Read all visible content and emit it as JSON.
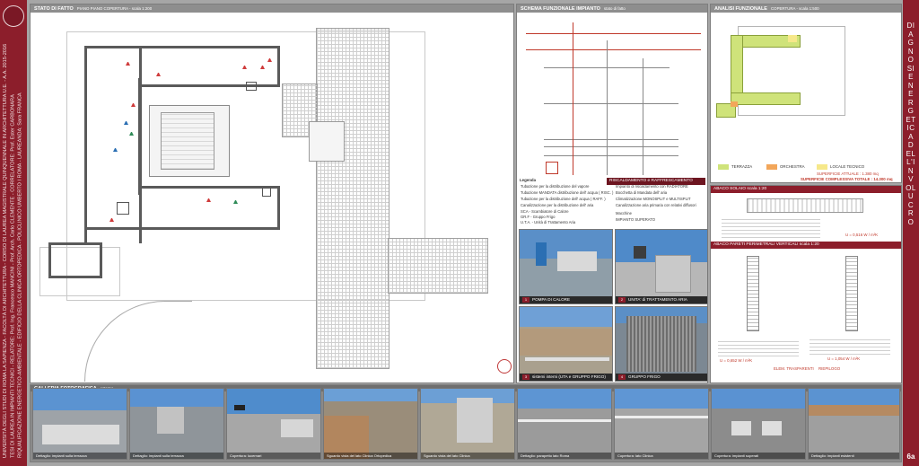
{
  "left_strip": {
    "lines": [
      "UNIVERSITÀ DEGLI STUDI DI ROMA LA SAPIENZA - FACOLTÀ DI ARCHITETTURA - CORSO DI LAUREA MAGISTRALE QUINQUENNALE IN ARCHITETTURA U.E. - A.A. 2015-2016",
      "TESI DI LAUREA IN IMPIANTI TECNICI - RELATORE: Prof. Ing. Francesco MANCINI - Prof. Arch. Carlo CLEMENTE - CORRELATORE: Prof. Ester CARBONARA",
      "RIQUALIFICAZIONE ENERGETICO-AMBIENTALE - EDIFICIO DELLA CLINICA ORTOPEDICA - POLICLINICO UMBERTO I ROMA - LAUREANDA: Sara FRANCA"
    ]
  },
  "right_strip": {
    "title": "DIAGNOSI ENERGETICA DELL'INVOLUCRO",
    "page_number": "6a"
  },
  "plan_panel": {
    "header": "STATO DI FATTO",
    "subheader": "PIANO PIANO COPERTURA - scala 1:200"
  },
  "schema_panel": {
    "header": "SCHEMA FUNZIONALE IMPIANTO",
    "subheader": "stato di fatto",
    "labels": [
      "RISCALDAMENTO e RAFFRESCAMENTO",
      "ACQUA POTABILE",
      "ACS"
    ],
    "legend_title": "Legenda",
    "legend_items": [
      "Tubazione per la distribuzione del vapore",
      "Tubazione MANDATA distribuzione dell' acqua ( RISC. )",
      "Tubazione per la distribuzione dell' acqua ( RAFF. )",
      "Canalizzazione per la distribuzione dell' aria",
      "SCA - Scambiatore di Calore",
      "GR.F - Gruppo Frigo",
      "U.T.A. - Unità di Trattamento Aria"
    ],
    "legend_items_right": [
      "Impianto di riscaldamento con RADIATORE",
      "Bocchetta di Mandata dell' aria",
      "Climatizzazione MONOSPLIT e MULTISPLIT",
      "Canalizzazione aria primaria con relativi diffusori",
      "Macchine",
      "IMPIANTO SUPERATO"
    ],
    "photos": [
      {
        "num": "1",
        "caption": "POMPA DI CALORE"
      },
      {
        "num": "2",
        "caption": "UNITA' di TRATTAMENTO ARIA"
      },
      {
        "num": "3",
        "caption": "sistemi interni (UTA e GRUPPO FRIGO)"
      },
      {
        "num": "4",
        "caption": "GRUPPO FRIGO"
      }
    ]
  },
  "analysis_panel": {
    "header": "ANALISI FUNZIONALE",
    "subheader": "COPERTURA - scala 1:500",
    "legend": [
      "TERRAZZA",
      "ORCHESTRA",
      "LOCALE TECNICO"
    ],
    "surface_actual": "SUPERFICIE ATTUALE : 1.380 mq",
    "surface_total": "SUPERFICIE COMPLESSIVA TOTALE : 14.300 mq"
  },
  "detail_panel": {
    "header1": "ABACO SOLAIO",
    "header1_scale": "scala 1:20",
    "header2": "ABACO PARETI PERIMETRALI VERTICALI",
    "header2_scale": "scala 1:20",
    "u_value": "U = 0,516 W / m²K",
    "u_value2": "U = 0,652 W / m²K",
    "u_value3": "U = 1,054 W / m²K",
    "detail_notes": [
      "ELEM. TRASPARENTI",
      "RIEPILOGO"
    ]
  },
  "gallery": {
    "header": "GALLERIA FOTOGRAFICA",
    "subheader": "esterno",
    "photos": [
      "Dettaglio: impianti sulla terrazza",
      "Dettaglio: impianti sulla terrazza",
      "Copertura: lucernari",
      "Sguardo vista del lato Clinica Ortopedica",
      "Sguardo vista del lato Clinica",
      "Dettaglio: parapetto lato Roma",
      "Copertura: lato Clinica",
      "Copertura: impianti superati",
      "Dettaglio: impianti esistenti",
      "Dettaglio: impianti superati"
    ]
  },
  "colors": {
    "brand": "#8c1e2b",
    "header_bg": "#8e8e8e",
    "panel_bg": "#ffffff",
    "terrace": "#cfe37a",
    "orchestra": "#f2a65a",
    "technical": "#f6e88a"
  }
}
